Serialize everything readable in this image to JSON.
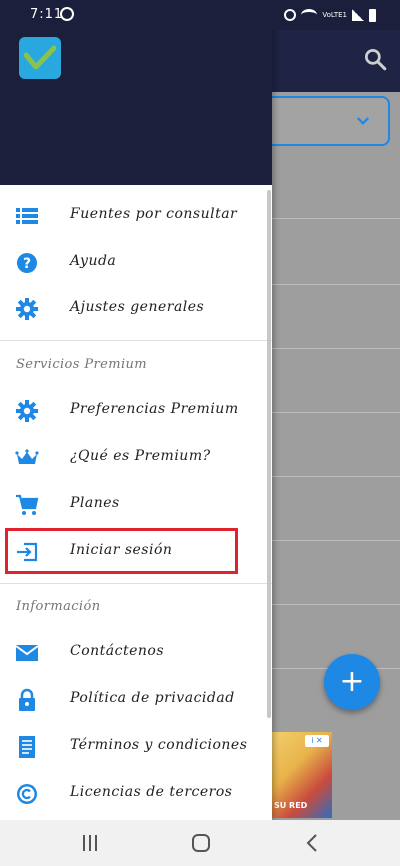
{
  "status_bar": {
    "time": "7:11",
    "network_label": "VoLTE1"
  },
  "drawer": {
    "menu_main": [
      {
        "label": "Fuentes por consultar",
        "icon": "list-icon"
      },
      {
        "label": "Ayuda",
        "icon": "help-icon"
      },
      {
        "label": "Ajustes generales",
        "icon": "gear-icon"
      }
    ],
    "premium_section": {
      "title": "Servicios Premium",
      "items": [
        {
          "label": "Preferencias Premium",
          "icon": "gear-icon"
        },
        {
          "label": "¿Qué es Premium?",
          "icon": "crown-icon"
        },
        {
          "label": "Planes",
          "icon": "cart-icon"
        },
        {
          "label": "Iniciar sesión",
          "icon": "login-icon"
        }
      ]
    },
    "info_section": {
      "title": "Información",
      "items": [
        {
          "label": "Contáctenos",
          "icon": "mail-icon"
        },
        {
          "label": "Política de privacidad",
          "icon": "lock-icon"
        },
        {
          "label": "Términos y condiciones",
          "icon": "document-icon"
        },
        {
          "label": "Licencias de terceros",
          "icon": "copyright-icon"
        }
      ]
    }
  },
  "background_app": {
    "fab_label": "+",
    "ad_info": "i ✕",
    "ad_text": "SU RED"
  },
  "colors": {
    "accent": "#1e88e5",
    "header": "#1b1f3b",
    "highlight": "#e0212e",
    "logo": "#29a8e0"
  }
}
